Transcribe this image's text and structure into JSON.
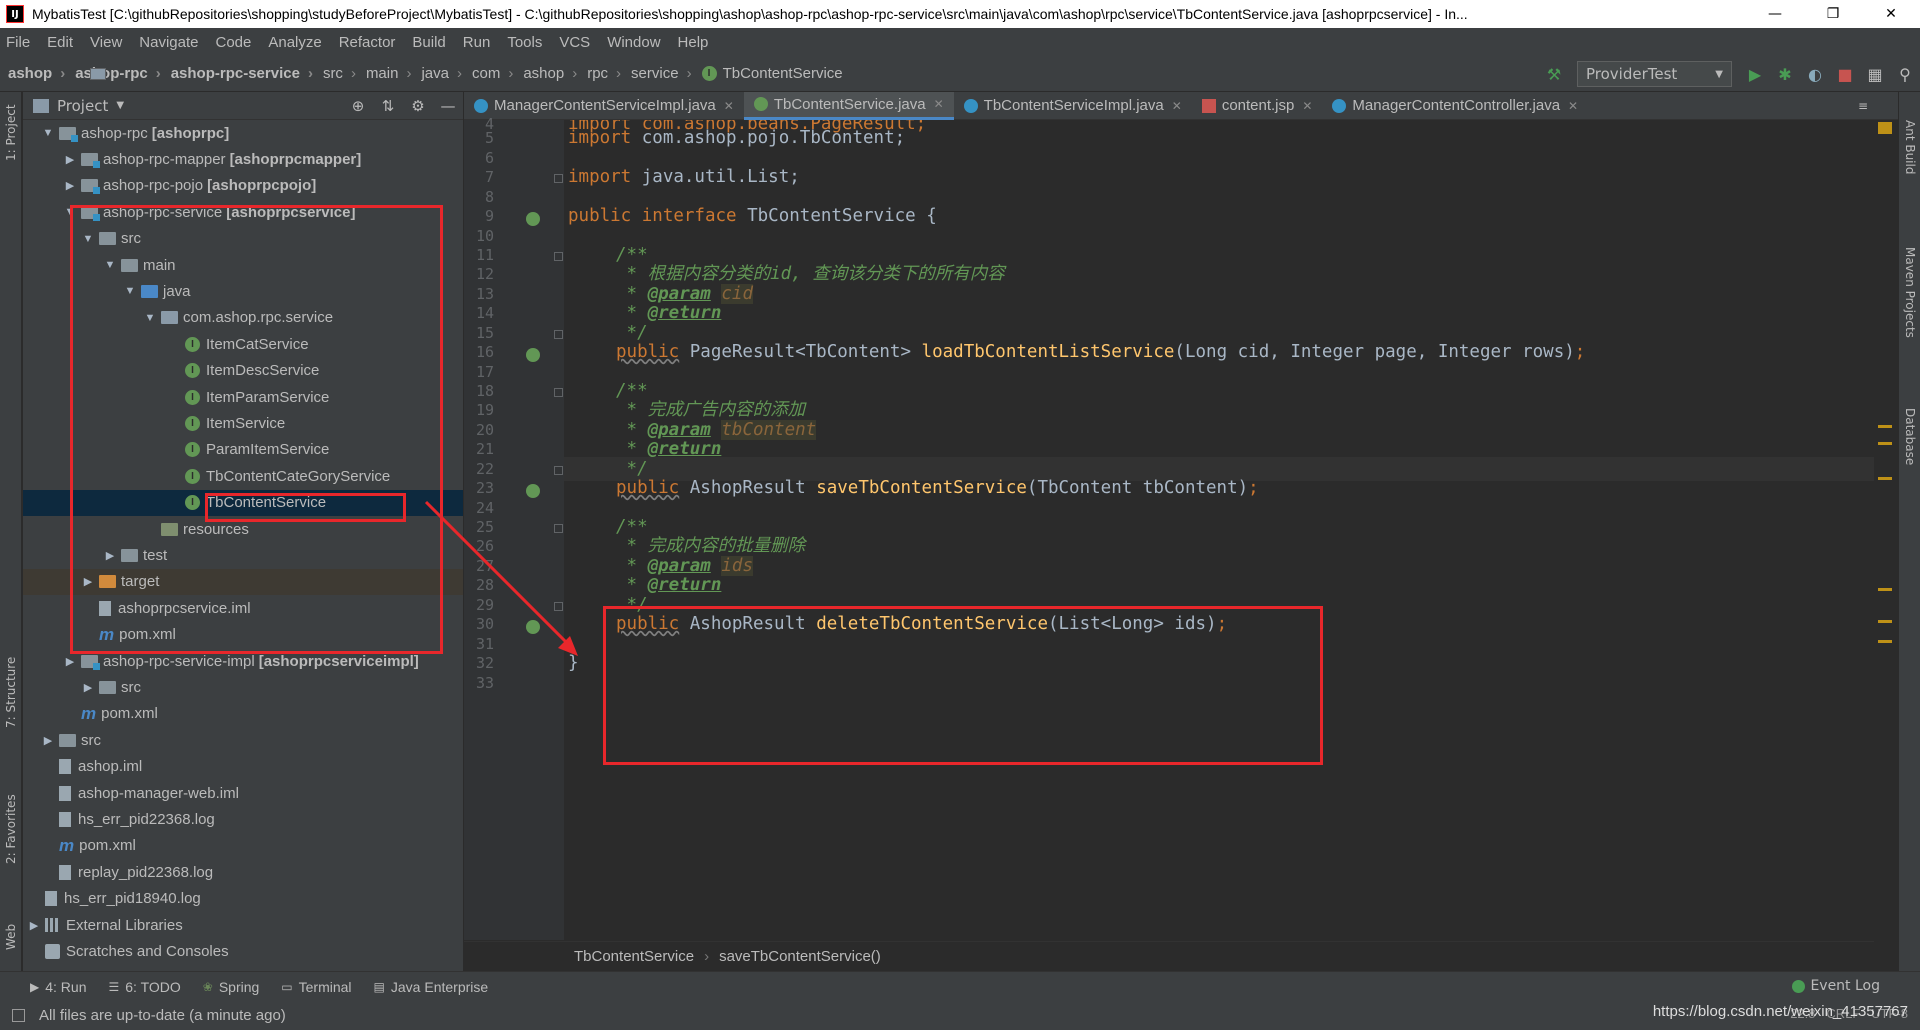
{
  "window": {
    "title": "MybatisTest [C:\\githubRepositories\\shopping\\studyBeforeProject\\MybatisTest] - C:\\githubRepositories\\shopping\\ashop\\ashop-rpc\\ashop-rpc-service\\src\\main\\java\\com\\ashop\\rpc\\service\\TbContentService.java [ashoprpcservice] - In...",
    "app_icon": "IJ"
  },
  "menu": [
    "File",
    "Edit",
    "View",
    "Navigate",
    "Code",
    "Analyze",
    "Refactor",
    "Build",
    "Run",
    "Tools",
    "VCS",
    "Window",
    "Help"
  ],
  "breadcrumbs": [
    {
      "label": "ashop",
      "bold": true
    },
    {
      "label": "ashop-rpc",
      "bold": true
    },
    {
      "label": "ashop-rpc-service",
      "bold": true
    },
    {
      "label": "src"
    },
    {
      "label": "main"
    },
    {
      "label": "java"
    },
    {
      "label": "com"
    },
    {
      "label": "ashop"
    },
    {
      "label": "rpc"
    },
    {
      "label": "service"
    },
    {
      "label": "TbContentService"
    }
  ],
  "run_config": {
    "label": "ProviderTest"
  },
  "project_panel": {
    "title": "Project",
    "tree": [
      {
        "label": "ashop-rpc",
        "suffix": "[ashoprpc]",
        "icon": "module-folder",
        "arrow": "down"
      },
      {
        "label": "ashop-rpc-mapper",
        "suffix": "[ashoprpcmapper]",
        "icon": "module-folder",
        "arrow": "right"
      },
      {
        "label": "ashop-rpc-pojo",
        "suffix": "[ashoprpcpojo]",
        "icon": "module-folder",
        "arrow": "right"
      },
      {
        "label": "ashop-rpc-service",
        "suffix": "[ashoprpcservice]",
        "icon": "module-folder",
        "arrow": "down"
      },
      {
        "label": "src",
        "icon": "folder",
        "arrow": "down"
      },
      {
        "label": "main",
        "icon": "folder",
        "arrow": "down"
      },
      {
        "label": "java",
        "icon": "source-folder",
        "arrow": "down"
      },
      {
        "label": "com.ashop.rpc.service",
        "icon": "package",
        "arrow": "down"
      },
      {
        "label": "ItemCatService",
        "icon": "interface"
      },
      {
        "label": "ItemDescService",
        "icon": "interface"
      },
      {
        "label": "ItemParamService",
        "icon": "interface"
      },
      {
        "label": "ItemService",
        "icon": "interface"
      },
      {
        "label": "ParamItemService",
        "icon": "interface"
      },
      {
        "label": "TbContentCateGoryService",
        "icon": "interface"
      },
      {
        "label": "TbContentService",
        "icon": "interface",
        "selected": true
      },
      {
        "label": "resources",
        "icon": "resources-folder"
      },
      {
        "label": "test",
        "icon": "folder",
        "arrow": "right"
      },
      {
        "label": "target",
        "icon": "excluded-folder",
        "arrow": "right"
      },
      {
        "label": "ashoprpcservice.iml",
        "icon": "iml-file"
      },
      {
        "label": "pom.xml",
        "icon": "maven-file"
      },
      {
        "label": "ashop-rpc-service-impl",
        "suffix": "[ashoprpcserviceimpl]",
        "icon": "module-folder",
        "arrow": "right"
      },
      {
        "label": "src",
        "icon": "folder",
        "arrow": "right"
      },
      {
        "label": "pom.xml",
        "icon": "maven-file"
      },
      {
        "label": "src",
        "icon": "folder",
        "arrow": "right"
      },
      {
        "label": "ashop.iml",
        "icon": "iml-file"
      },
      {
        "label": "ashop-manager-web.iml",
        "icon": "iml-file"
      },
      {
        "label": "hs_err_pid22368.log",
        "icon": "log-file"
      },
      {
        "label": "pom.xml",
        "icon": "maven-file"
      },
      {
        "label": "replay_pid22368.log",
        "icon": "log-file"
      },
      {
        "label": "hs_err_pid18940.log",
        "icon": "log-file"
      },
      {
        "label": "External Libraries",
        "icon": "libraries",
        "arrow": "right"
      },
      {
        "label": "Scratches and Consoles",
        "icon": "scratches"
      }
    ]
  },
  "editor_tabs": [
    {
      "label": "ManagerContentServiceImpl.java",
      "icon": "class"
    },
    {
      "label": "TbContentService.java",
      "icon": "interface",
      "active": true
    },
    {
      "label": "TbContentServiceImpl.java",
      "icon": "class"
    },
    {
      "label": "content.jsp",
      "icon": "jsp"
    },
    {
      "label": "ManagerContentController.java",
      "icon": "class"
    }
  ],
  "code": {
    "line_numbers": [
      "4",
      "5",
      "6",
      "7",
      "8",
      "9",
      "10",
      "11",
      "12",
      "13",
      "14",
      "15",
      "16",
      "17",
      "18",
      "19",
      "20",
      "21",
      "22",
      "23",
      "24",
      "25",
      "26",
      "27",
      "28",
      "29",
      "30",
      "31",
      "32",
      "33"
    ],
    "line_4": "import com.ashop.beans.PageResult;",
    "line_5_kw": "import",
    "line_5_rest": " com.ashop.pojo.TbContent;",
    "line_7_kw": "import",
    "line_7_rest": " java.util.List;",
    "line_9_kw": "public interface",
    "line_9_rest": " TbContentService {",
    "line_11": "/**",
    "line_12": " * 根据内容分类的id, 查询该分类下的所有内容",
    "line_13_star": " * ",
    "line_13_tag": "@param",
    "line_13_val": "cid",
    "line_14_star": " * ",
    "line_14_tag": "@return",
    "line_15": " */",
    "line_16_kw": "public",
    "line_16_type": " PageResult<TbContent> ",
    "line_16_fn": "loadTbContentListService",
    "line_16_params": "(Long cid, Integer page, Integer rows)",
    "line_16_semi": ";",
    "line_18": "/**",
    "line_19": " * 完成广告内容的添加",
    "line_20_star": " * ",
    "line_20_tag": "@param",
    "line_20_val": "tbContent",
    "line_21_star": " * ",
    "line_21_tag": "@return",
    "line_22": " */",
    "line_23_kw": "public",
    "line_23_type": " AshopResult ",
    "line_23_fn": "saveTbContentService",
    "line_23_params": "(TbContent tbContent)",
    "line_23_semi": ";",
    "line_25": "/**",
    "line_26": " * 完成内容的批量删除",
    "line_27_star": " * ",
    "line_27_tag": "@param",
    "line_27_val": "ids",
    "line_28_star": " * ",
    "line_28_tag": "@return",
    "line_29": " */",
    "line_30_kw": "public",
    "line_30_type": " AshopResult ",
    "line_30_fn": "deleteTbContentService",
    "line_30_params": "(List<Long> ids)",
    "line_30_semi": ";",
    "line_32": "}"
  },
  "editor_breadcrumb": [
    "TbContentService",
    "saveTbContentService()"
  ],
  "bottom_tools": [
    {
      "label": "4: Run",
      "icon": "run-icon"
    },
    {
      "label": "6: TODO",
      "icon": "todo-icon"
    },
    {
      "label": "Spring",
      "icon": "spring-icon"
    },
    {
      "label": "Terminal",
      "icon": "terminal-icon"
    },
    {
      "label": "Java Enterprise",
      "icon": "javaee-icon"
    }
  ],
  "event_log": "Event Log",
  "left_tabs": [
    "1: Project",
    "7: Structure",
    "2: Favorites",
    "Web"
  ],
  "right_tabs": [
    "Ant Build",
    "Maven Projects",
    "Database"
  ],
  "status": {
    "message": "All files are up-to-date (a minute ago)",
    "position": "22:8",
    "line_sep": "CRLF",
    "encoding": "UTF-8",
    "watermark": "https://blog.csdn.net/weixin_41357767"
  },
  "colors": {
    "annotation_red": "#e8272b",
    "selection": "#0d293e",
    "keyword": "#cc7832",
    "function": "#ffc66d",
    "comment": "#629755"
  }
}
